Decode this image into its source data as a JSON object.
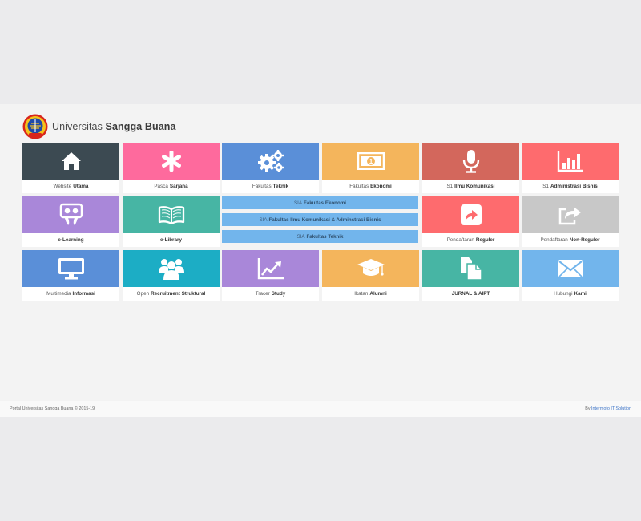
{
  "brand": {
    "prefix": "Universitas",
    "bold": "Sangga Buana"
  },
  "tiles": [
    {
      "pre": "Website",
      "bold": "Utama",
      "color": "#3c4a52",
      "icon": "home-icon"
    },
    {
      "pre": "Pasca",
      "bold": "Sarjana",
      "color": "#fe6a9d",
      "icon": "asterisk-icon"
    },
    {
      "pre": "Fakultas",
      "bold": "Teknik",
      "color": "#5a8fd8",
      "icon": "gears-icon"
    },
    {
      "pre": "Fakultas",
      "bold": "Ekonomi",
      "color": "#f4b55c",
      "icon": "money-icon"
    },
    {
      "pre": "S1",
      "bold": "Ilmu Komunikasi",
      "color": "#d3675c",
      "icon": "microphone-icon"
    },
    {
      "pre": "S1",
      "bold": "Administrasi Bisnis",
      "color": "#fe6b6e",
      "icon": "bar-chart-icon"
    },
    {
      "pre": "",
      "bold": "e-Learning",
      "color": "#a987d9",
      "icon": "slideshare-icon"
    },
    {
      "pre": "",
      "bold": "e-Library",
      "color": "#47b5a4",
      "icon": "book-icon"
    },
    {
      "pre": "Pendaftaran",
      "bold": "Reguler",
      "color": "#fe6b6e",
      "icon": "share-square-icon"
    },
    {
      "pre": "Pendaftaran",
      "bold": "Non-Reguler",
      "color": "#c8c8c8",
      "icon": "share-outline-icon"
    },
    {
      "pre": "Multimedia",
      "bold": "Informasi",
      "color": "#5a8fd8",
      "icon": "desktop-icon"
    },
    {
      "pre": "Open",
      "bold": "Recruitment Struktural",
      "color": "#1cadc5",
      "icon": "users-icon"
    },
    {
      "pre": "Tracer",
      "bold": "Study",
      "color": "#a987d9",
      "icon": "line-chart-icon"
    },
    {
      "pre": "Ikatan",
      "bold": "Alumni",
      "color": "#f4b55c",
      "icon": "graduation-cap-icon"
    },
    {
      "pre": "",
      "bold": "JURNAL & AIPT",
      "color": "#47b5a4",
      "icon": "files-icon"
    },
    {
      "pre": "Hubungi",
      "bold": "Kami",
      "color": "#72b5ec",
      "icon": "envelope-icon"
    }
  ],
  "sia": [
    {
      "pre": "SIA",
      "bold": "Fakultas Ekonomi"
    },
    {
      "pre": "SIA",
      "bold": "Fakultas Ilmu Komunikasi & Adminstrasi Bisnis"
    },
    {
      "pre": "SIA",
      "bold": "Fakultas Teknik"
    }
  ],
  "footer": {
    "copyright": "Portal Universitas Sangga Buana © 2015-19",
    "by": "By",
    "company": "Intermofo IT Solution"
  }
}
